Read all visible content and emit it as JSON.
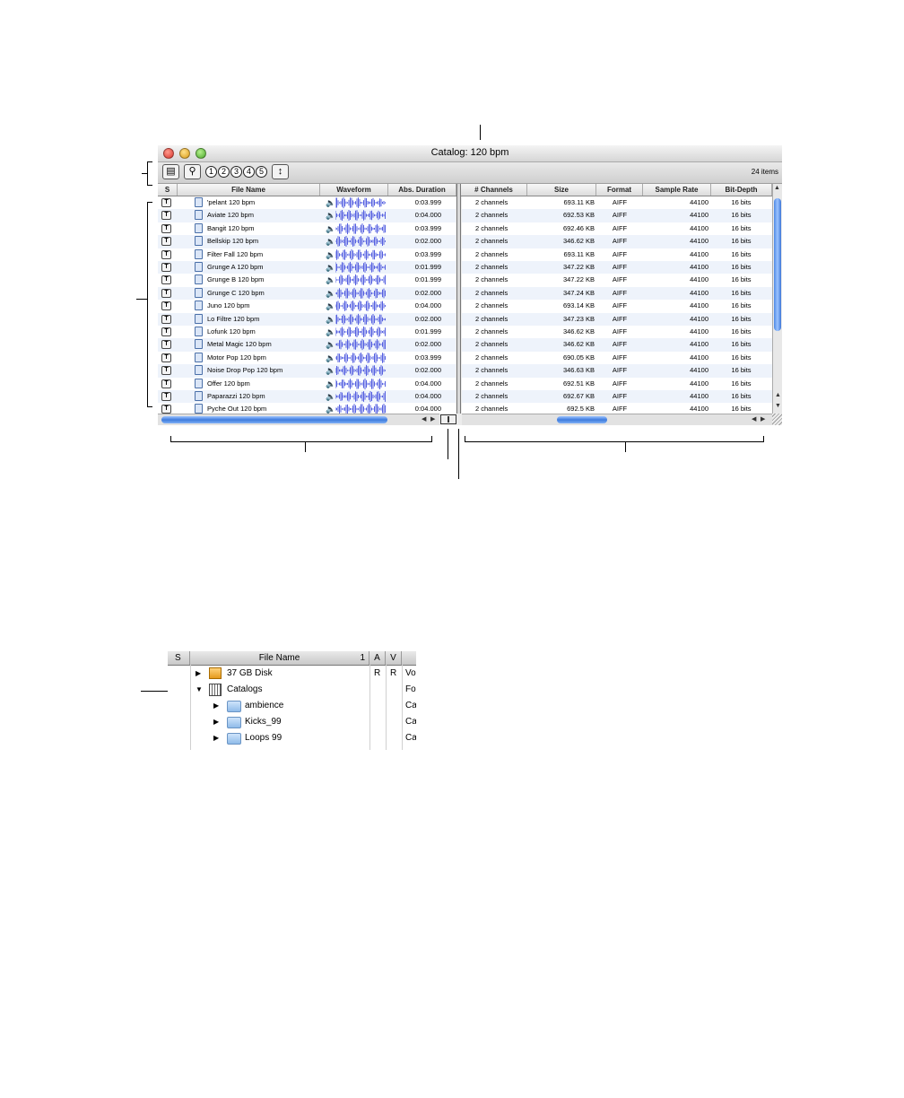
{
  "window": {
    "title": "Catalog: 120 bpm",
    "item_count": "24 items",
    "toolbar_numbers": [
      "1",
      "2",
      "3",
      "4",
      "5"
    ],
    "left_columns": [
      "S",
      "File Name",
      "Waveform",
      "Abs. Duration"
    ],
    "right_columns": [
      "# Channels",
      "Size",
      "Format",
      "Sample Rate",
      "Bit-Depth"
    ],
    "rows": [
      {
        "s": "T",
        "name": "'pelant 120 bpm",
        "duration": "0:03.999",
        "channels": "2 channels",
        "size": "693.11 KB",
        "format": "AIFF",
        "rate": "44100",
        "depth": "16 bits"
      },
      {
        "s": "T",
        "name": "Aviate 120 bpm",
        "duration": "0:04.000",
        "channels": "2 channels",
        "size": "692.53 KB",
        "format": "AIFF",
        "rate": "44100",
        "depth": "16 bits"
      },
      {
        "s": "T",
        "name": "Bangit 120 bpm",
        "duration": "0:03.999",
        "channels": "2 channels",
        "size": "692.46 KB",
        "format": "AIFF",
        "rate": "44100",
        "depth": "16 bits"
      },
      {
        "s": "T",
        "name": "Bellskip 120 bpm",
        "duration": "0:02.000",
        "channels": "2 channels",
        "size": "346.62 KB",
        "format": "AIFF",
        "rate": "44100",
        "depth": "16 bits"
      },
      {
        "s": "T",
        "name": "Filter Fall 120 bpm",
        "duration": "0:03.999",
        "channels": "2 channels",
        "size": "693.11 KB",
        "format": "AIFF",
        "rate": "44100",
        "depth": "16 bits"
      },
      {
        "s": "T",
        "name": "Grunge A 120 bpm",
        "duration": "0:01.999",
        "channels": "2 channels",
        "size": "347.22 KB",
        "format": "AIFF",
        "rate": "44100",
        "depth": "16 bits"
      },
      {
        "s": "T",
        "name": "Grunge B 120 bpm",
        "duration": "0:01.999",
        "channels": "2 channels",
        "size": "347.22 KB",
        "format": "AIFF",
        "rate": "44100",
        "depth": "16 bits"
      },
      {
        "s": "T",
        "name": "Grunge C 120 bpm",
        "duration": "0:02.000",
        "channels": "2 channels",
        "size": "347.24 KB",
        "format": "AIFF",
        "rate": "44100",
        "depth": "16 bits"
      },
      {
        "s": "T",
        "name": "Juno 120 bpm",
        "duration": "0:04.000",
        "channels": "2 channels",
        "size": "693.14 KB",
        "format": "AIFF",
        "rate": "44100",
        "depth": "16 bits"
      },
      {
        "s": "T",
        "name": "Lo Filtre 120 bpm",
        "duration": "0:02.000",
        "channels": "2 channels",
        "size": "347.23 KB",
        "format": "AIFF",
        "rate": "44100",
        "depth": "16 bits"
      },
      {
        "s": "T",
        "name": "Lofunk 120 bpm",
        "duration": "0:01.999",
        "channels": "2 channels",
        "size": "346.62 KB",
        "format": "AIFF",
        "rate": "44100",
        "depth": "16 bits"
      },
      {
        "s": "T",
        "name": "Metal Magic 120 bpm",
        "duration": "0:02.000",
        "channels": "2 channels",
        "size": "346.62 KB",
        "format": "AIFF",
        "rate": "44100",
        "depth": "16 bits"
      },
      {
        "s": "T",
        "name": "Motor Pop 120 bpm",
        "duration": "0:03.999",
        "channels": "2 channels",
        "size": "690.05 KB",
        "format": "AIFF",
        "rate": "44100",
        "depth": "16 bits"
      },
      {
        "s": "T",
        "name": "Noise Drop Pop 120 bpm",
        "duration": "0:02.000",
        "channels": "2 channels",
        "size": "346.63 KB",
        "format": "AIFF",
        "rate": "44100",
        "depth": "16 bits"
      },
      {
        "s": "T",
        "name": "Offer 120 bpm",
        "duration": "0:04.000",
        "channels": "2 channels",
        "size": "692.51 KB",
        "format": "AIFF",
        "rate": "44100",
        "depth": "16 bits"
      },
      {
        "s": "T",
        "name": "Paparazzi 120 bpm",
        "duration": "0:04.000",
        "channels": "2 channels",
        "size": "692.67 KB",
        "format": "AIFF",
        "rate": "44100",
        "depth": "16 bits"
      },
      {
        "s": "T",
        "name": "Pyche Out 120 bpm",
        "duration": "0:04.000",
        "channels": "2 channels",
        "size": "692.5 KB",
        "format": "AIFF",
        "rate": "44100",
        "depth": "16 bits"
      }
    ]
  },
  "browser": {
    "columns": [
      "S",
      "File Name",
      "1",
      "A",
      "V"
    ],
    "rows": [
      {
        "name": "37 GB Disk",
        "a": "R",
        "v": "R",
        "extra": "Vo",
        "indent": 0,
        "expanded": false,
        "icon": "disk-icon"
      },
      {
        "name": "Catalogs",
        "a": "",
        "v": "",
        "extra": "Fol",
        "indent": 0,
        "expanded": true,
        "icon": "catalog-icon"
      },
      {
        "name": "ambience",
        "a": "",
        "v": "",
        "extra": "Ca",
        "indent": 1,
        "expanded": false,
        "icon": "folder-icon"
      },
      {
        "name": "Kicks_99",
        "a": "",
        "v": "",
        "extra": "Ca",
        "indent": 1,
        "expanded": false,
        "icon": "folder-icon"
      },
      {
        "name": "Loops 99",
        "a": "",
        "v": "",
        "extra": "Ca",
        "indent": 1,
        "expanded": false,
        "icon": "folder-icon"
      }
    ]
  },
  "colors": {
    "scroll_thumb": "#3e7bdd",
    "waveform": "#5560e0",
    "row_alt": "#eef3fb"
  }
}
